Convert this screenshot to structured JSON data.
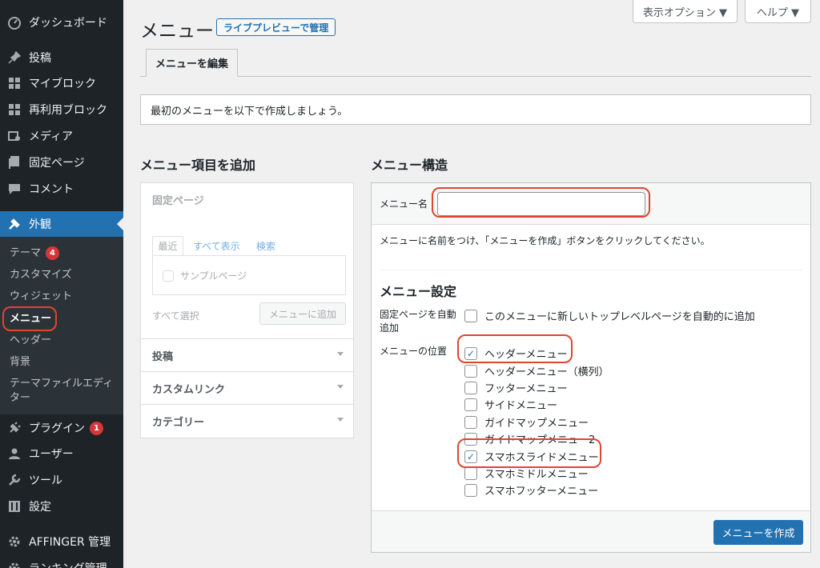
{
  "sidebar": {
    "items": [
      {
        "icon": "dashboard-icon",
        "label": "ダッシュボード"
      },
      {
        "icon": "pin-icon",
        "label": "投稿"
      },
      {
        "icon": "blocks-icon",
        "label": "マイブロック"
      },
      {
        "icon": "blocks-icon",
        "label": "再利用ブロック"
      },
      {
        "icon": "media-icon",
        "label": "メディア"
      },
      {
        "icon": "page-icon",
        "label": "固定ページ"
      },
      {
        "icon": "comment-icon",
        "label": "コメント"
      },
      {
        "icon": "appearance-icon",
        "label": "外観"
      },
      {
        "icon": "plugin-icon",
        "label": "プラグイン",
        "badge": "1"
      },
      {
        "icon": "user-icon",
        "label": "ユーザー"
      },
      {
        "icon": "wrench-icon",
        "label": "ツール"
      },
      {
        "icon": "settings-icon",
        "label": "設定"
      },
      {
        "icon": "gear-icon",
        "label": "AFFINGER 管理"
      },
      {
        "icon": "gear-icon",
        "label": "ランキング管理"
      }
    ],
    "submenu": [
      {
        "label": "テーマ",
        "badge": "4"
      },
      {
        "label": "カスタマイズ"
      },
      {
        "label": "ウィジェット"
      },
      {
        "label": "メニュー"
      },
      {
        "label": "ヘッダー"
      },
      {
        "label": "背景"
      },
      {
        "label": "テーマファイルエディ"
      },
      {
        "label": "ター"
      }
    ]
  },
  "topbar": {
    "screen_options": "表示オプション ▼",
    "help": "ヘルプ ▼"
  },
  "header": {
    "title": "メニュー",
    "live_preview": "ライブプレビューで管理",
    "tab": "メニューを編集"
  },
  "notice": "最初のメニューを以下で作成しましょう。",
  "left": {
    "heading": "メニュー項目を追加",
    "pages_title": "固定ページ",
    "tabs": [
      "最近",
      "すべて表示",
      "検索"
    ],
    "sample_page": "サンプルページ",
    "select_all": "すべて選択",
    "add_button": "メニューに追加",
    "sections": [
      "投稿",
      "カスタムリンク",
      "カテゴリー"
    ]
  },
  "right": {
    "heading": "メニュー構造",
    "name_label": "メニュー名",
    "name_value": "",
    "instruction": "メニューに名前をつけ、「メニューを作成」ボタンをクリックしてください。",
    "settings_heading": "メニュー設定",
    "auto_add_label_1": "固定ページを自動",
    "auto_add_label_2": "追加",
    "auto_add_text": "このメニューに新しいトップレベルページを自動的に追加",
    "auto_add_checked": false,
    "location_label": "メニューの位置",
    "locations": [
      {
        "label": "ヘッダーメニュー",
        "checked": true
      },
      {
        "label": "ヘッダーメニュー（横列）",
        "checked": false
      },
      {
        "label": "フッターメニュー",
        "checked": false
      },
      {
        "label": "サイドメニュー",
        "checked": false
      },
      {
        "label": "ガイドマップメニュー",
        "checked": false
      },
      {
        "label": "ガイドマップメニュー2",
        "checked": false
      },
      {
        "label": "スマホスライドメニュー",
        "checked": true
      },
      {
        "label": "スマホミドルメニュー",
        "checked": false
      },
      {
        "label": "スマホフッターメニュー",
        "checked": false
      }
    ],
    "create_button": "メニューを作成"
  },
  "colors": {
    "sidebar_bg": "#1d2327",
    "accent": "#2271b1",
    "highlight_ring": "#e0452f",
    "badge": "#d63638"
  }
}
